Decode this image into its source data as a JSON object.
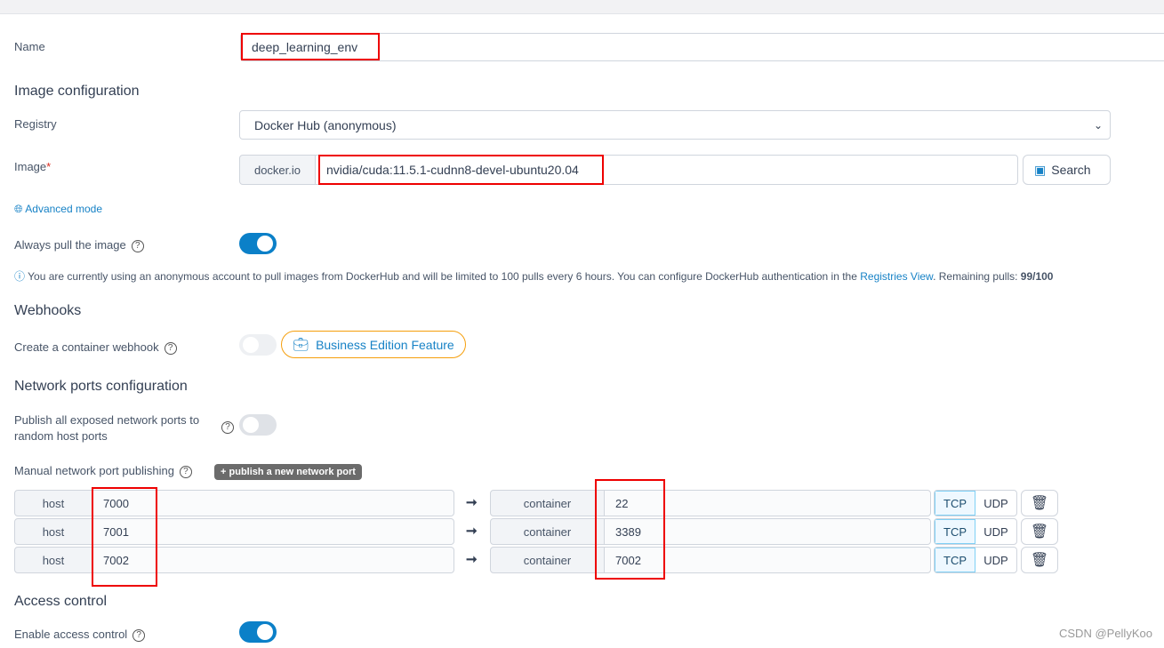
{
  "form": {
    "name_label": "Name",
    "name_value": "deep_learning_env",
    "image_section": "Image configuration",
    "registry_label": "Registry",
    "registry_value": "Docker Hub (anonymous)",
    "image_label": "Image",
    "required_mark": "*",
    "image_prefix": "docker.io",
    "image_value": "nvidia/cuda:11.5.1-cudnn8-devel-ubuntu20.04",
    "search_label": "Search",
    "advanced_mode": "Advanced mode",
    "always_pull_label": "Always pull the image",
    "always_pull": true,
    "info_text": "You are currently using an anonymous account to pull images from DockerHub and will be limited to 100 pulls every 6 hours. You can configure DockerHub authentication in the ",
    "info_link": "Registries View",
    "info_remaining": ". Remaining pulls: ",
    "info_count": "99/100",
    "webhooks_section": "Webhooks",
    "webhook_label": "Create a container webhook",
    "webhook_enabled": false,
    "business_badge": "Business Edition Feature",
    "network_section": "Network ports configuration",
    "publish_all_label": "Publish all exposed network ports to random host ports",
    "publish_all": false,
    "manual_label": "Manual network port publishing",
    "add_port_label": "publish a new network port",
    "host_label": "host",
    "container_label": "container",
    "tcp": "TCP",
    "udp": "UDP",
    "ports": [
      {
        "host": "7000",
        "container": "22",
        "protocol": "TCP"
      },
      {
        "host": "7001",
        "container": "3389",
        "protocol": "TCP"
      },
      {
        "host": "7002",
        "container": "7002",
        "protocol": "TCP"
      }
    ],
    "access_section": "Access control",
    "access_label": "Enable access control",
    "access_enabled": true
  },
  "watermark": "CSDN @PellyKoo",
  "colors": {
    "accent": "#0b80c8",
    "highlight": "#ee0000",
    "badge_border": "#f59e0b"
  }
}
